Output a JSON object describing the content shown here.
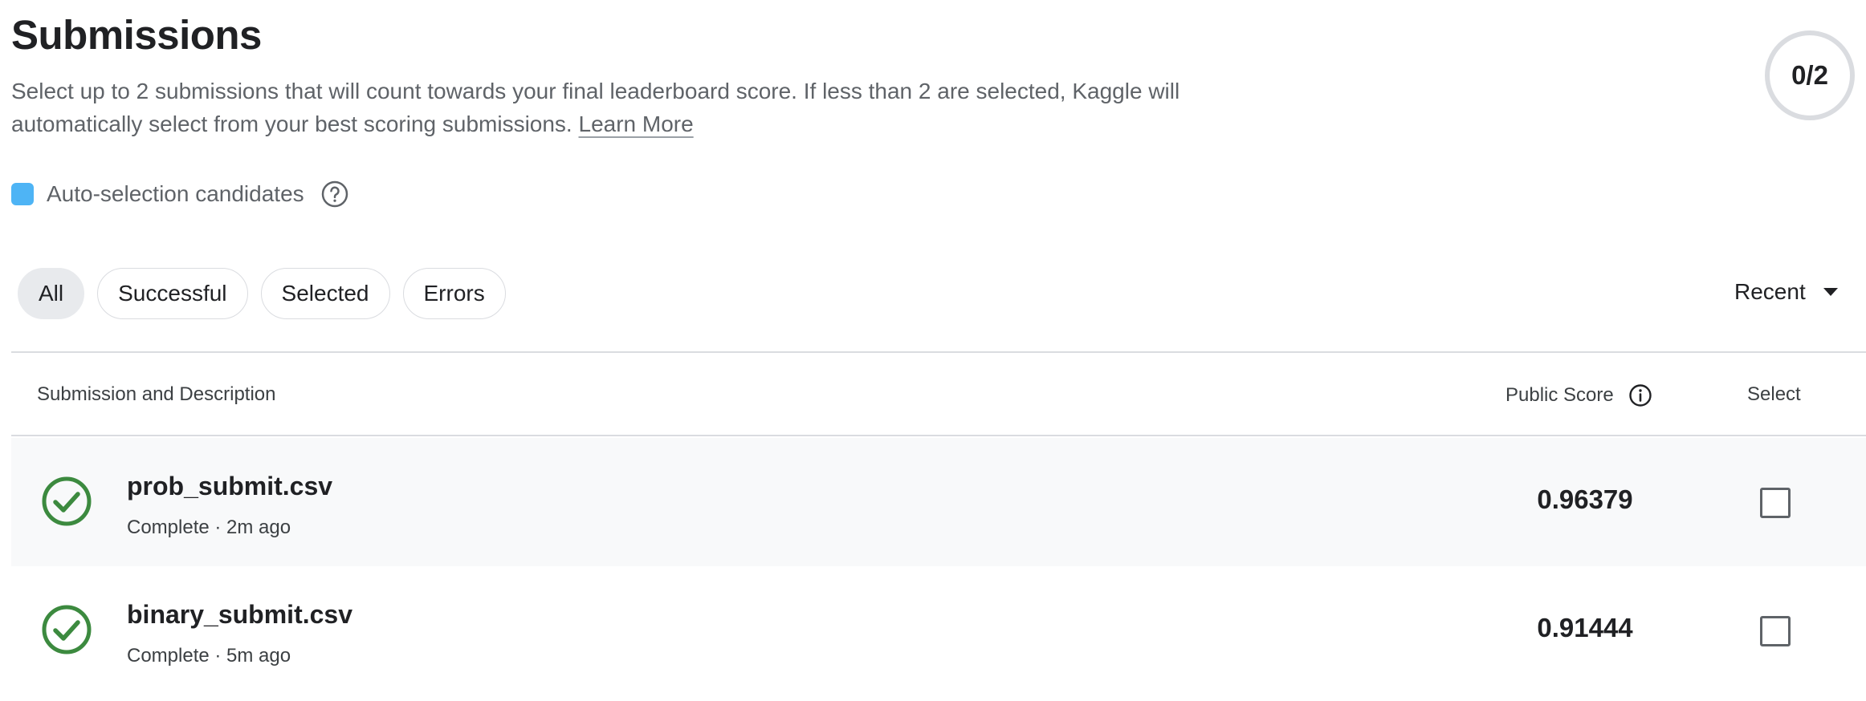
{
  "header": {
    "title": "Submissions",
    "description": "Select up to 2 submissions that will count towards your final leaderboard score. If less than 2 are selected, Kaggle will automatically select from your best scoring submissions.",
    "learn_more": "Learn More",
    "counter": "0/2"
  },
  "legend": {
    "label": "Auto-selection candidates",
    "swatch_color": "#4eb4f5",
    "help_icon": "help-circle-icon"
  },
  "filters": {
    "chips": [
      "All",
      "Successful",
      "Selected",
      "Errors"
    ],
    "active": "All"
  },
  "sort": {
    "label": "Recent",
    "icon": "caret-down-icon"
  },
  "table": {
    "columns": {
      "description": "Submission and Description",
      "score": "Public Score",
      "select": "Select"
    },
    "rows": [
      {
        "file": "prob_submit.csv",
        "meta": "Complete · 2m ago",
        "score": "0.96379",
        "selected": false,
        "status_icon": "check-circle-icon"
      },
      {
        "file": "binary_submit.csv",
        "meta": "Complete · 5m ago",
        "score": "0.91444",
        "selected": false,
        "status_icon": "check-circle-icon"
      }
    ]
  },
  "colors": {
    "success": "#3c8a3f",
    "active_chip": "#e8eaed"
  }
}
